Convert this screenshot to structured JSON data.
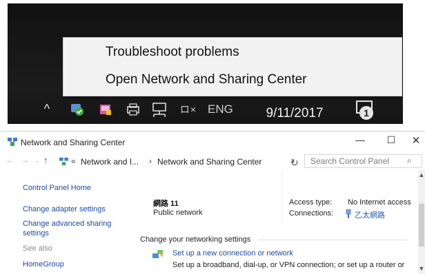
{
  "context_menu": {
    "items": [
      {
        "label": "Troubleshoot problems"
      },
      {
        "label": "Open Network and Sharing Center"
      }
    ]
  },
  "taskbar": {
    "chevron_icon": "^",
    "volume_text": "ロ×",
    "language": "ENG",
    "date": "9/11/2017",
    "notification_count": "1",
    "icons": [
      "chevron-up-icon",
      "security-shield-icon",
      "mail-icon",
      "printer-icon",
      "network-icon",
      "volume-muted-icon",
      "notification-icon"
    ]
  },
  "window": {
    "title": "Network and Sharing Center",
    "minimize_glyph": "—",
    "maximize_glyph": "☐",
    "close_glyph": "✕",
    "nav": {
      "back_glyph": "←",
      "forward_glyph": "→",
      "recent_glyph": "⌄",
      "up_glyph": "↑",
      "address_chevrons": "«",
      "breadcrumb": [
        "Network and I...",
        "Network and Sharing Center"
      ],
      "separator": "›",
      "dropdown_glyph": "⌄",
      "refresh_glyph": "↻",
      "search_placeholder": "Search Control Panel",
      "search_glyph": "⌕"
    },
    "left_pane": {
      "control_panel_home": "Control Panel Home",
      "links": [
        "Change adapter settings",
        "Change advanced sharing settings"
      ],
      "see_also": "See also",
      "see_also_links": [
        "HomeGroup"
      ]
    },
    "main": {
      "network_name": "網路  11",
      "network_type": "Public network",
      "access_type_label": "Access type:",
      "access_type_value": "No Internet access",
      "connections_label": "Connections:",
      "connections_value": "乙太網路",
      "settings_heading": "Change your networking settings",
      "setup_link": "Set up a new connection or network",
      "setup_desc": "Set up a broadband, dial-up, or VPN connection; or set up a router or"
    },
    "scroll": {
      "up_glyph": "▲",
      "down_glyph": "▼"
    }
  },
  "colors": {
    "link": "#1a4aa6",
    "taskbar": "#1b1b1b",
    "menu_bg": "#f2f2f2",
    "shield_green": "#3fae3f"
  }
}
